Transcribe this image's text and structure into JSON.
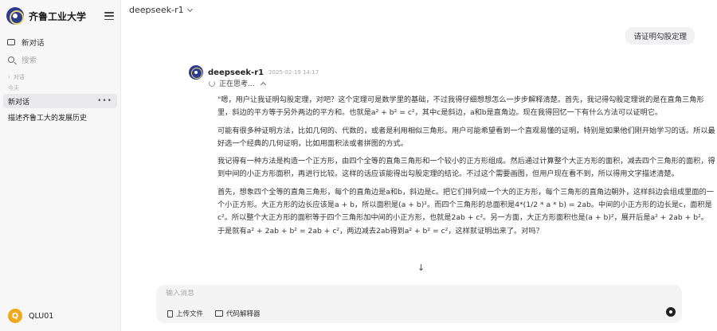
{
  "sidebar": {
    "brand": "齐鲁工业大学",
    "new_chat": "新对话",
    "search_placeholder": "搜索",
    "section_chats": "对话",
    "section_today": "今天",
    "history": [
      {
        "label": "新对话",
        "active": true
      },
      {
        "label": "描述齐鲁工大的发展历史",
        "active": false
      }
    ],
    "more": "•••",
    "user": {
      "initial": "Q",
      "name": "QLU01"
    }
  },
  "header": {
    "model": "deepseek-r1"
  },
  "conversation": {
    "user_message": "请证明勾股定理",
    "bot": {
      "name": "deepseek-r1",
      "time": "2025-02-19 14:17",
      "thinking": "正在思考...",
      "paragraphs": [
        "\"嗯，用户让我证明勾股定理，对吧？这个定理可是数学里的基础，不过我得仔细想想怎么一步步解释清楚。首先，我记得勾股定理说的是在直角三角形里，斜边的平方等于另外两边的平方和。也就是a² + b² = c²，其中c是斜边，a和b是直角边。现在我得回忆一下有什么方法可以证明它。",
        "可能有很多种证明方法，比如几何的、代数的，或者是利用相似三角形。用户可能希望看到一个直观易懂的证明，特别是如果他们刚开始学习的话。所以最好选一个经典的几何证明，比如用面积法或者拼图的方式。",
        "我记得有一种方法是构造一个正方形，由四个全等的直角三角形和一个较小的正方形组成。然后通过计算整个大正方形的面积，减去四个三角形的面积，得到中间的小正方形面积，再进行比较。这样的话应该能得出勾股定理的结论。不过这个需要画图，但用户现在看不到，所以得用文字描述清楚。",
        "首先，想象四个全等的直角三角形，每个的直角边是a和b，斜边是c。把它们排列成一个大的正方形，每个三角形的直角边朝外，这样斜边会组成里面的一个小正方形。大正方形的边长应该是a + b，所以面积是(a + b)²。而四个三角形的总面积是4*(1/2 * a * b) = 2ab。中间的小正方形的边长是c，面积是c²。所以整个大正方形的面积等于四个三角形加中间的小正方形，也就是2ab + c²。另一方面，大正方形面积也是(a + b)²，展开后是a² + 2ab + b²。于是就有a² + 2ab + b² = 2ab + c²，两边减去2ab得到a² + b² = c²，这样就证明出来了。对吗？"
      ]
    }
  },
  "composer": {
    "placeholder": "输入消息",
    "upload_label": "上传文件",
    "code_label": "代码解释器"
  }
}
